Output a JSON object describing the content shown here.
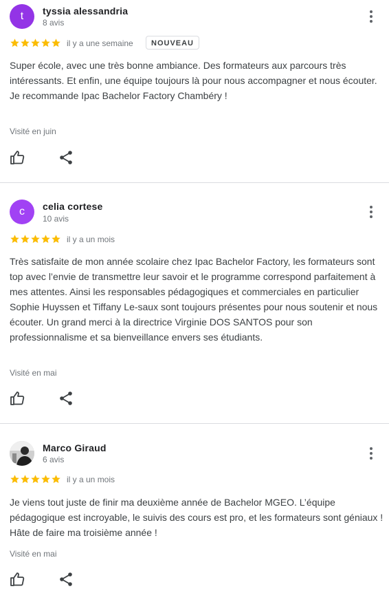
{
  "reviews": [
    {
      "avatar_letter": "t",
      "avatar_color": "#9334e6",
      "name": "tyssia alessandria",
      "count": "8 avis",
      "rating": 5,
      "date": "il y a une semaine",
      "badge": "NOUVEAU",
      "text": "Super école, avec une très bonne ambiance. Des formateurs aux parcours très intéressants. Et enfin, une équipe toujours là pour nous accompagner et nous écouter.\nJe recommande Ipac Bachelor Factory Chambéry !",
      "visited": "Visité en juin"
    },
    {
      "avatar_letter": "c",
      "avatar_color": "#a142f4",
      "name": "celia cortese",
      "count": "10 avis",
      "rating": 5,
      "date": "il y a un mois",
      "text": "Très satisfaite de mon année scolaire chez Ipac Bachelor Factory, les formateurs sont top avec l’envie de transmettre leur savoir et le programme correspond parfaitement à mes attentes. Ainsi les responsables pédagogiques et commerciales en particulier Sophie Huyssen et Tiffany Le-saux sont toujours présentes pour nous soutenir et nous écouter. Un grand merci à la directrice Virginie DOS SANTOS pour son professionnalisme et sa bienveillance envers ses étudiants.",
      "visited": "Visité en mai"
    },
    {
      "avatar_letter": "",
      "avatar_color": "#5f6368",
      "name": "Marco Giraud",
      "count": "6 avis",
      "rating": 5,
      "date": "il y a un mois",
      "text": "Je viens tout juste de finir ma deuxième année de Bachelor MGEO. L’équipe pédagogique est incroyable, le suivis des cours est pro, et les formateurs sont géniaux ! Hâte de faire ma troisième année !",
      "visited": "Visité en mai"
    }
  ],
  "icons": {
    "star_color": "#fbbc04",
    "menu": "more-vert-icon",
    "like": "thumb-up-icon",
    "share": "share-icon"
  }
}
